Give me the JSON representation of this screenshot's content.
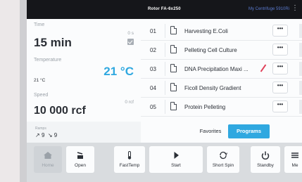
{
  "topbar": {
    "rotor": "Rotor FA-6x250",
    "device": "My Centrifuge 5910Ri",
    "more": "⋮"
  },
  "time": {
    "label": "Time",
    "value": "15 min",
    "counter": "0 s"
  },
  "temperature": {
    "label": "Temperature",
    "current": "21 °C",
    "set": "21 °C"
  },
  "speed": {
    "label": "Speed",
    "value": "10 000 rcf",
    "current": "0 rcf"
  },
  "ramps": {
    "label": "Ramps",
    "accel": "9",
    "decel": "9"
  },
  "programs": [
    {
      "num": "01",
      "name": "Harvesting E.Coli",
      "menu": "•••"
    },
    {
      "num": "02",
      "name": "Pelleting Cell Culture",
      "menu": "•••"
    },
    {
      "num": "03",
      "name": "DNA Precipitation Maxi ...",
      "menu": "•••"
    },
    {
      "num": "04",
      "name": "Ficoll Density Gradient",
      "menu": "•••"
    },
    {
      "num": "05",
      "name": "Protein Pelleting",
      "menu": "•••"
    }
  ],
  "tabs": {
    "favorites": "Favorites",
    "programs": "Programs"
  },
  "toolbar": {
    "home": "Home",
    "open": "Open",
    "fasttemp": "FastTemp",
    "start": "Start",
    "shortspin": "Short Spin",
    "standby": "Standby",
    "menu": "Me"
  },
  "colors": {
    "accent": "#2fa8e0",
    "warning": "#e0415a",
    "link": "#5b7bd0"
  }
}
